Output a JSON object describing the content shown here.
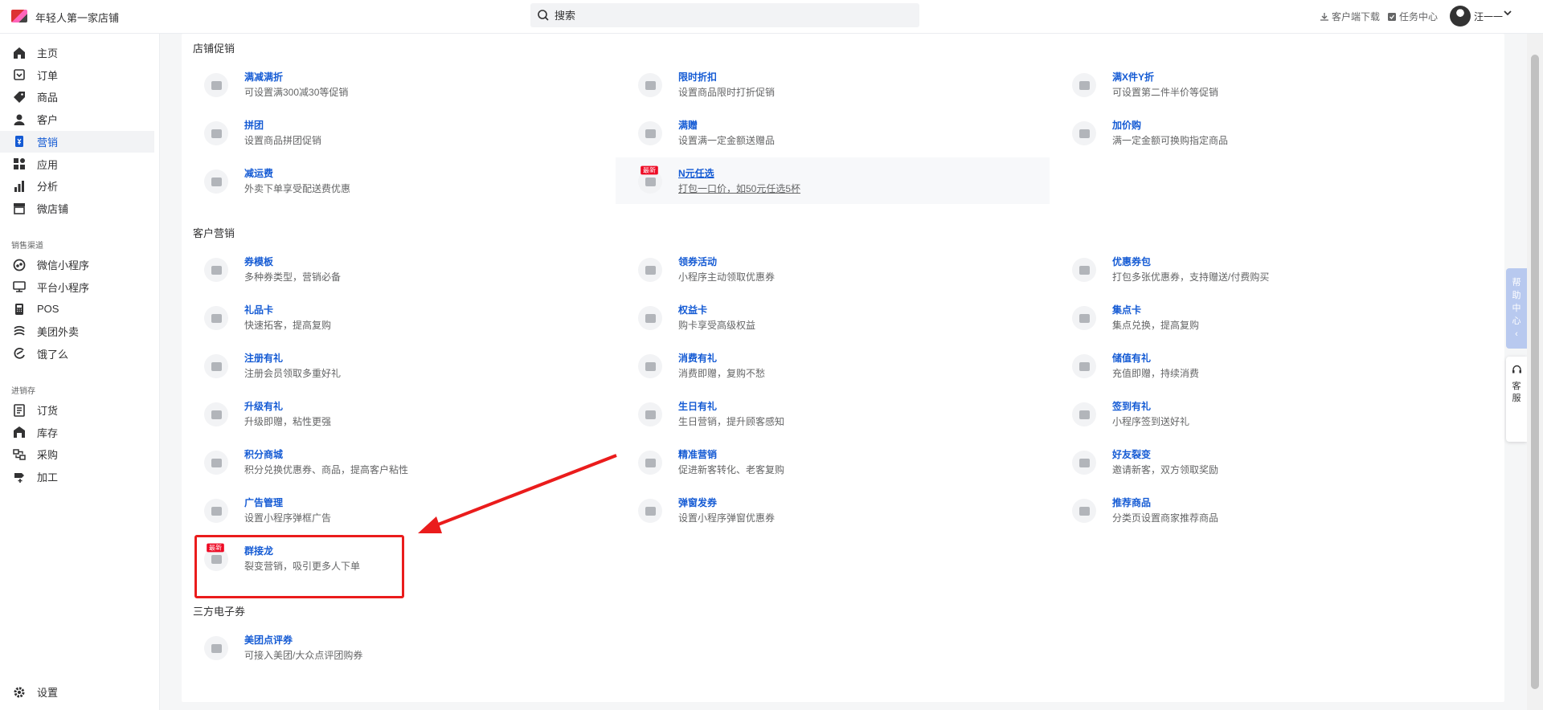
{
  "header": {
    "shop_name": "年轻人第一家店铺",
    "search": {
      "placeholder": "搜索"
    },
    "links": {
      "client_download": "客户端下载",
      "task_center": "任务中心"
    },
    "user_name": "汪一一"
  },
  "sidebar": {
    "items": [
      {
        "label": "主页",
        "icon": "home-icon"
      },
      {
        "label": "订单",
        "icon": "order-icon"
      },
      {
        "label": "商品",
        "icon": "tag-icon"
      },
      {
        "label": "客户",
        "icon": "user-icon"
      },
      {
        "label": "营销",
        "icon": "marketing-icon",
        "active": true
      },
      {
        "label": "应用",
        "icon": "apps-icon"
      },
      {
        "label": "分析",
        "icon": "chart-icon"
      },
      {
        "label": "微店铺",
        "icon": "store-icon"
      }
    ],
    "group_sales": "销售渠道",
    "sales_items": [
      {
        "label": "微信小程序",
        "icon": "wechat-mini-icon"
      },
      {
        "label": "平台小程序",
        "icon": "platform-mini-icon"
      },
      {
        "label": "POS",
        "icon": "pos-icon"
      },
      {
        "label": "美团外卖",
        "icon": "meituan-icon"
      },
      {
        "label": "饿了么",
        "icon": "eleme-icon"
      }
    ],
    "group_inventory": "进销存",
    "inventory_items": [
      {
        "label": "订货",
        "icon": "purchase-order-icon"
      },
      {
        "label": "库存",
        "icon": "warehouse-icon"
      },
      {
        "label": "采购",
        "icon": "procure-icon"
      },
      {
        "label": "加工",
        "icon": "process-icon"
      }
    ],
    "settings": "设置"
  },
  "sections": [
    {
      "title": "店铺促销",
      "items": [
        {
          "title": "满减满折",
          "desc": "可设置满300减30等促销",
          "icon": "discount-tag-icon"
        },
        {
          "title": "限时折扣",
          "desc": "设置商品限时打折促销",
          "icon": "limited-discount-icon"
        },
        {
          "title": "满X件Y折",
          "desc": "可设置第二件半价等促销",
          "icon": "percent-icon"
        },
        {
          "title": "拼团",
          "desc": "设置商品拼团促销",
          "icon": "group-buy-icon"
        },
        {
          "title": "满赠",
          "desc": "设置满一定金额送赠品",
          "icon": "gift-threshold-icon"
        },
        {
          "title": "加价购",
          "desc": "满一定金额可换购指定商品",
          "icon": "cart-icon"
        },
        {
          "title": "减运费",
          "desc": "外卖下单享受配送费优惠",
          "icon": "delivery-fee-icon"
        },
        {
          "title": "N元任选",
          "desc": "打包一口价，如50元任选5杯",
          "icon": "n-yuan-icon",
          "badge": "最新",
          "highlight": true
        }
      ]
    },
    {
      "title": "客户营销",
      "items": [
        {
          "title": "券模板",
          "desc": "多种券类型，营销必备",
          "icon": "coupon-template-icon"
        },
        {
          "title": "领券活动",
          "desc": "小程序主动领取优惠券",
          "icon": "coupon-claim-icon"
        },
        {
          "title": "优惠券包",
          "desc": "打包多张优惠券，支持赠送/付费购买",
          "icon": "coupon-pack-icon"
        },
        {
          "title": "礼品卡",
          "desc": "快速拓客，提高复购",
          "icon": "gift-card-icon"
        },
        {
          "title": "权益卡",
          "desc": "购卡享受高级权益",
          "icon": "crown-icon"
        },
        {
          "title": "集点卡",
          "desc": "集点兑换，提高复购",
          "icon": "gift-box-icon"
        },
        {
          "title": "注册有礼",
          "desc": "注册会员领取多重好礼",
          "icon": "register-card-icon"
        },
        {
          "title": "消费有礼",
          "desc": "消费即赠，复购不愁",
          "icon": "consume-gift-icon"
        },
        {
          "title": "储值有礼",
          "desc": "充值即赠，持续消费",
          "icon": "stored-value-icon"
        },
        {
          "title": "升级有礼",
          "desc": "升级即赠，粘性更强",
          "icon": "upgrade-icon"
        },
        {
          "title": "生日有礼",
          "desc": "生日营销，提升顾客感知",
          "icon": "birthday-cake-icon"
        },
        {
          "title": "签到有礼",
          "desc": "小程序签到送好礼",
          "icon": "checkin-icon"
        },
        {
          "title": "积分商城",
          "desc": "积分兑换优惠券、商品，提高客户粘性",
          "icon": "points-icon"
        },
        {
          "title": "精准营销",
          "desc": "促进新客转化、老客复购",
          "icon": "target-user-icon"
        },
        {
          "title": "好友裂变",
          "desc": "邀请新客，双方领取奖励",
          "icon": "referral-icon"
        },
        {
          "title": "广告管理",
          "desc": "设置小程序弹框广告",
          "icon": "ad-icon"
        },
        {
          "title": "弹窗发券",
          "desc": "设置小程序弹窗优惠券",
          "icon": "popup-coupon-icon"
        },
        {
          "title": "推荐商品",
          "desc": "分类页设置商家推荐商品",
          "icon": "recommend-bag-icon"
        },
        {
          "title": "群接龙",
          "desc": "裂变营销，吸引更多人下单",
          "icon": "group-chain-icon",
          "badge": "最新"
        }
      ]
    },
    {
      "title": "三方电子券",
      "items": [
        {
          "title": "美团点评券",
          "desc": "可接入美团/大众点评团购券",
          "icon": "meituan-voucher-icon"
        }
      ]
    }
  ],
  "float": {
    "help": "帮助中心",
    "service": "客服"
  },
  "colors": {
    "accent": "#155bd4",
    "annotation": "#ea1c1c",
    "badge": "#ee0a24"
  }
}
